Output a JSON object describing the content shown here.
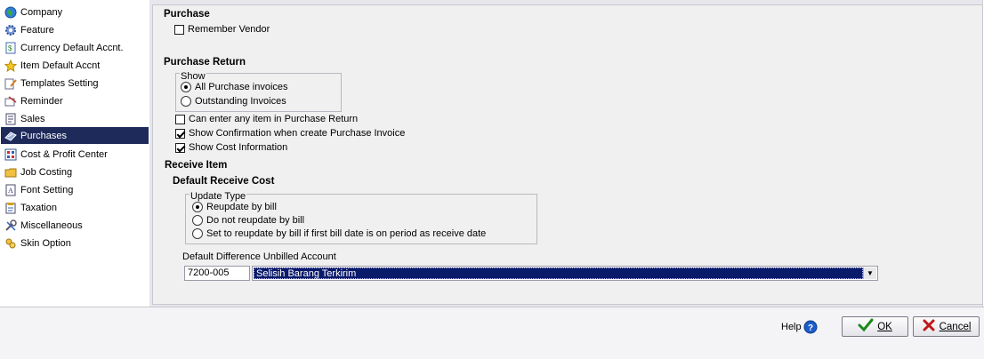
{
  "sidebar": {
    "items": [
      {
        "label": "Company",
        "icon": "globe-icon"
      },
      {
        "label": "Feature",
        "icon": "gear-icon"
      },
      {
        "label": "Currency Default Accnt.",
        "icon": "currency-document-icon"
      },
      {
        "label": "Item Default Accnt",
        "icon": "star-icon"
      },
      {
        "label": "Templates Setting",
        "icon": "template-icon"
      },
      {
        "label": "Reminder",
        "icon": "reminder-icon"
      },
      {
        "label": "Sales",
        "icon": "sales-document-icon"
      },
      {
        "label": "Purchases",
        "icon": "purchases-icon"
      },
      {
        "label": "Cost & Profit Center",
        "icon": "grid-chart-icon"
      },
      {
        "label": "Job Costing",
        "icon": "folder-icon"
      },
      {
        "label": "Font Setting",
        "icon": "font-document-icon"
      },
      {
        "label": "Taxation",
        "icon": "taxation-icon"
      },
      {
        "label": "Miscellaneous",
        "icon": "tools-icon"
      },
      {
        "label": "Skin Option",
        "icon": "skin-icon"
      }
    ],
    "active_index": 7
  },
  "purchase": {
    "header": "Purchase",
    "remember_vendor": {
      "label": "Remember Vendor",
      "checked": false
    }
  },
  "purchase_return": {
    "header": "Purchase Return",
    "show_group": {
      "title": "Show",
      "options": [
        {
          "label": "All Purchase invoices",
          "selected": true
        },
        {
          "label": "Outstanding Invoices",
          "selected": false
        }
      ]
    },
    "checks": [
      {
        "label": "Can enter any item in Purchase Return",
        "checked": false
      },
      {
        "label": "Show Confirmation when create Purchase Invoice",
        "checked": true
      },
      {
        "label": "Show Cost Information",
        "checked": true
      }
    ]
  },
  "receive_item": {
    "header": "Receive Item",
    "sub_header": "Default Receive Cost",
    "update_group": {
      "title": "Update Type",
      "options": [
        {
          "label": "Reupdate by bill",
          "selected": true
        },
        {
          "label": "Do not reupdate by bill",
          "selected": false
        },
        {
          "label": "Set to reupdate by bill if first bill date is on period as receive date",
          "selected": false
        }
      ]
    },
    "account_label": "Default Difference Unbilled Account",
    "account_code": "7200-005",
    "account_name": "Selisih Barang Terkirim"
  },
  "footer": {
    "help_label": "Help",
    "ok_label": "OK",
    "cancel_label": "Cancel"
  },
  "colors": {
    "active_bg": "#1e2a5a",
    "ok_check": "#1a8a1a",
    "cancel_x": "#c01818",
    "help_icon": "#1c5cc8"
  }
}
